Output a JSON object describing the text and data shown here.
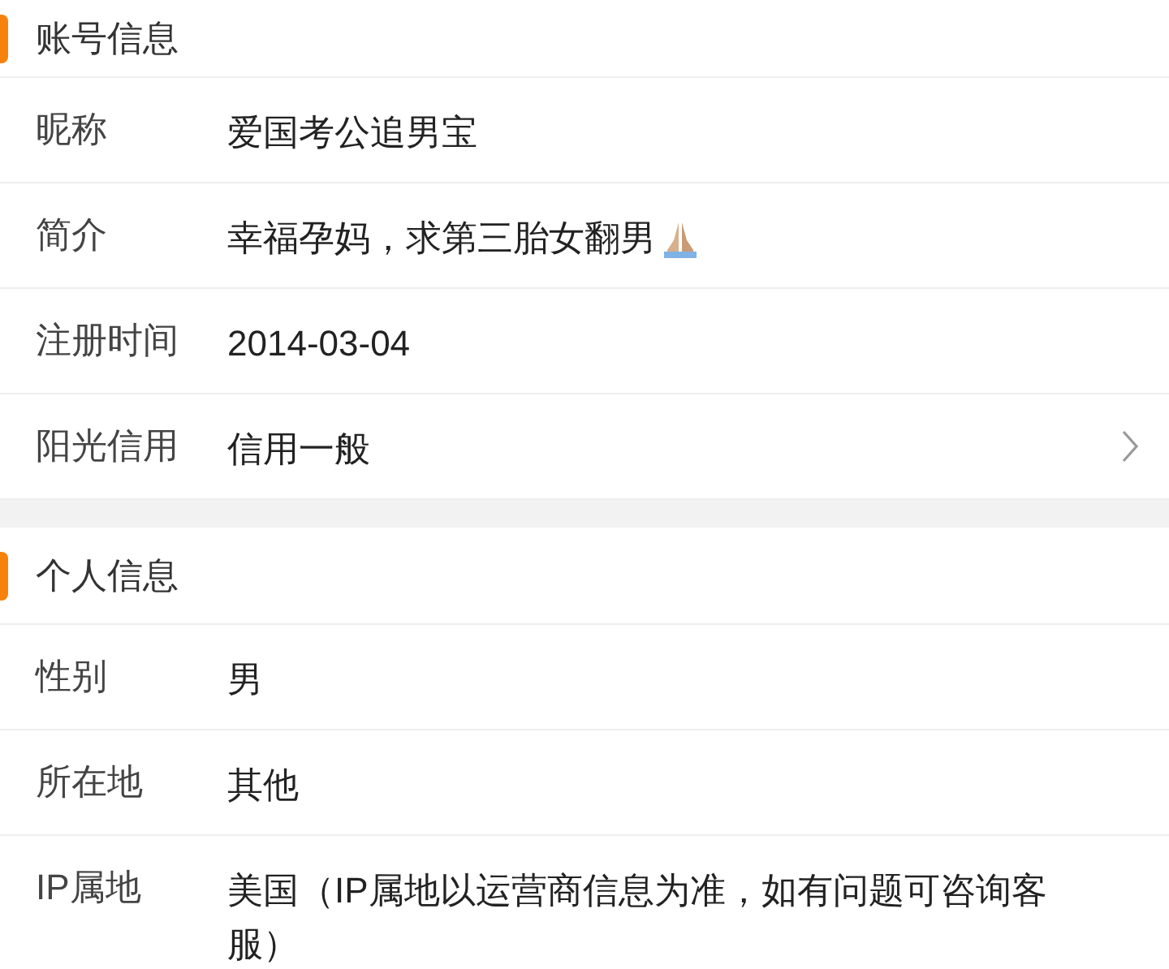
{
  "sections": [
    {
      "title": "账号信息",
      "rows": [
        {
          "kind": "plain",
          "label": "昵称",
          "value": "爱国考公追男宝"
        },
        {
          "kind": "plain",
          "label": "简介",
          "value": "幸福孕妈，求第三胎女翻男",
          "emoji": true
        },
        {
          "kind": "plain",
          "label": "注册时间",
          "value": "2014-03-04"
        },
        {
          "kind": "link",
          "label": "阳光信用",
          "value": "信用一般"
        }
      ]
    },
    {
      "title": "个人信息",
      "rows": [
        {
          "kind": "plain",
          "label": "性别",
          "value": "男"
        },
        {
          "kind": "plain",
          "label": "所在地",
          "value": "其他"
        },
        {
          "kind": "plain",
          "label": "IP属地",
          "value": "美国（IP属地以运营商信息为准，如有问题可咨询客服）"
        }
      ]
    }
  ]
}
